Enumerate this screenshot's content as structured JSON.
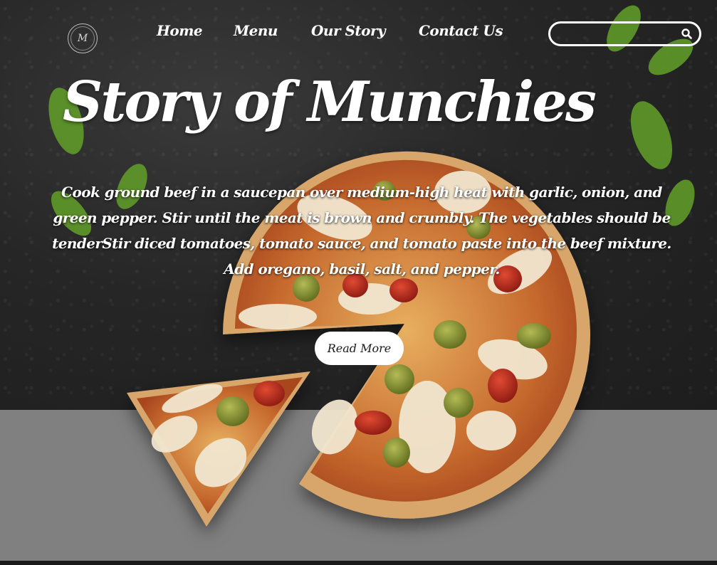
{
  "brand": {
    "logo_initial": "M"
  },
  "nav": {
    "items": [
      {
        "label": "Home"
      },
      {
        "label": "Menu"
      },
      {
        "label": "Our Story"
      },
      {
        "label": "Contact Us"
      }
    ]
  },
  "search": {
    "placeholder": "",
    "value": "",
    "icon": "search-icon"
  },
  "hero": {
    "title": "Story of Munchies",
    "description": "Cook ground beef in a saucepan over medium-high heat with garlic, onion, and green pepper. Stir until the meat is brown and crumbly. The vegetables should be tenderStir diced tomatoes, tomato sauce, and tomato paste into the beef mixture. Add oregano, basil, salt, and pepper.",
    "button_label": "Read More"
  },
  "colors": {
    "hero_background": "#262626",
    "floor": "#808080",
    "text": "#ffffff",
    "button_background": "#ffffff",
    "button_text": "#1a1a1a"
  }
}
